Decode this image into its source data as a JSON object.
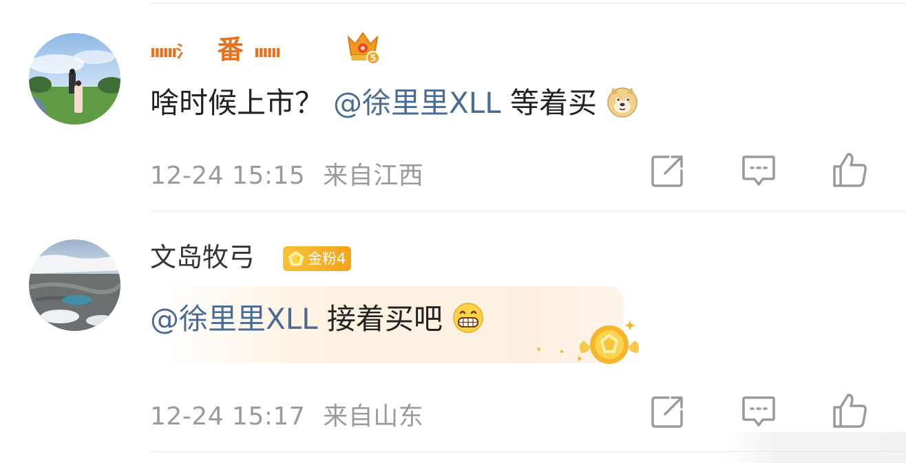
{
  "comments": [
    {
      "username_prefix": "ıııııı氵",
      "username_main": "番",
      "username_suffix": "ıııııı",
      "level_icon": "crown-level-5-icon",
      "level_text": "5",
      "content_text": "啥时候上市？",
      "mention": "@徐里里XLL",
      "content_after": " 等着买",
      "emoji": "doge-emoji",
      "timestamp": "12-24 15:15",
      "location": "来自江西"
    },
    {
      "username": "文岛牧弓",
      "fan_badge": "金粉4",
      "mention": "@徐里里XLL",
      "content_after": " 接着买吧",
      "emoji": "grin-emoji",
      "timestamp": "12-24 15:17",
      "location": "来自山东"
    }
  ],
  "actions": {
    "share_icon": "share-icon",
    "comment_icon": "comment-icon",
    "like_icon": "thumbs-up-icon"
  },
  "colors": {
    "username_vip": "#e8701a",
    "mention": "#4a6b92",
    "meta": "#9a9a9a",
    "badge": "#f3a31c",
    "highlight": "#fdf3e3"
  }
}
